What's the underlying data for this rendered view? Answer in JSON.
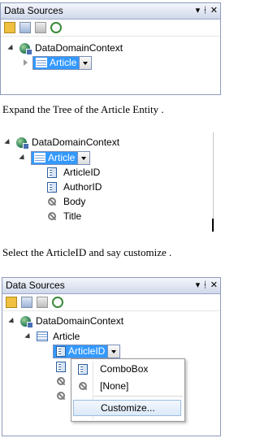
{
  "panel1": {
    "title": "Data Sources",
    "title_icons": [
      "dropdown-arrow-icon",
      "pin-icon",
      "close-icon"
    ],
    "toolbar_icons": [
      "add-data-source-icon",
      "edit-data-source-icon",
      "configure-icon",
      "refresh-icon"
    ],
    "tree": {
      "root": "DataDomainContext",
      "entity": "Article"
    }
  },
  "caption1": "Expand the Tree  of the Article Entity .",
  "panel2": {
    "tree": {
      "root": "DataDomainContext",
      "entity": "Article",
      "fields": [
        "ArticleID",
        "AuthorID",
        "Body",
        "Title"
      ]
    }
  },
  "caption2": "Select the ArticleID and say customize .",
  "panel3": {
    "title": "Data Sources",
    "title_icons": [
      "dropdown-arrow-icon",
      "pin-icon",
      "close-icon"
    ],
    "tree": {
      "root": "DataDomainContext",
      "entity": "Article",
      "selected_field": "ArticleID"
    },
    "menu": {
      "items": [
        {
          "label": "ComboBox",
          "icon": "field-icon"
        },
        {
          "label": "[None]",
          "icon": "none-icon"
        },
        {
          "label": "Customize...",
          "icon": ""
        }
      ]
    }
  },
  "colors": {
    "selection": "#3399ff",
    "titlebar": "#cfd8ea",
    "border": "#8e9bbc"
  }
}
